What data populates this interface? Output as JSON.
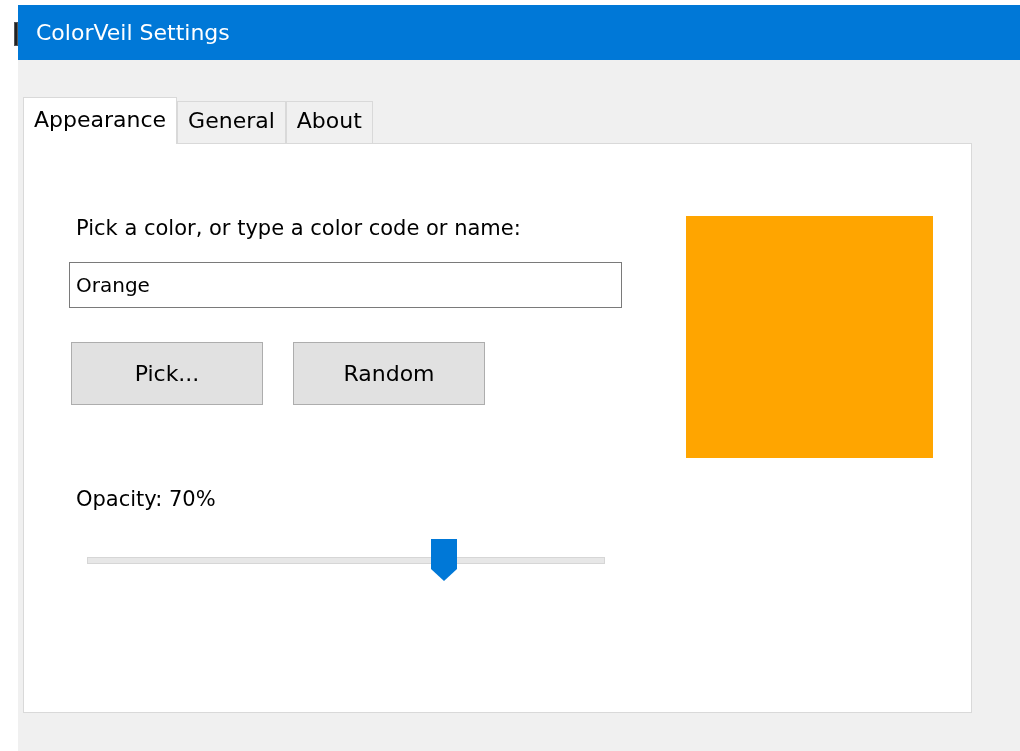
{
  "window": {
    "title": "ColorVeil Settings"
  },
  "tabs": [
    {
      "label": "Appearance",
      "selected": true
    },
    {
      "label": "General",
      "selected": false
    },
    {
      "label": "About",
      "selected": false
    }
  ],
  "color_prompt": "Pick a color, or type a color code or name:",
  "color_field": {
    "value": "Orange"
  },
  "buttons": [
    "Pick...",
    "Random"
  ],
  "preview": {
    "color": "#ffa500"
  },
  "opacity": {
    "label": "Opacity: 70%",
    "level": 0.69
  }
}
